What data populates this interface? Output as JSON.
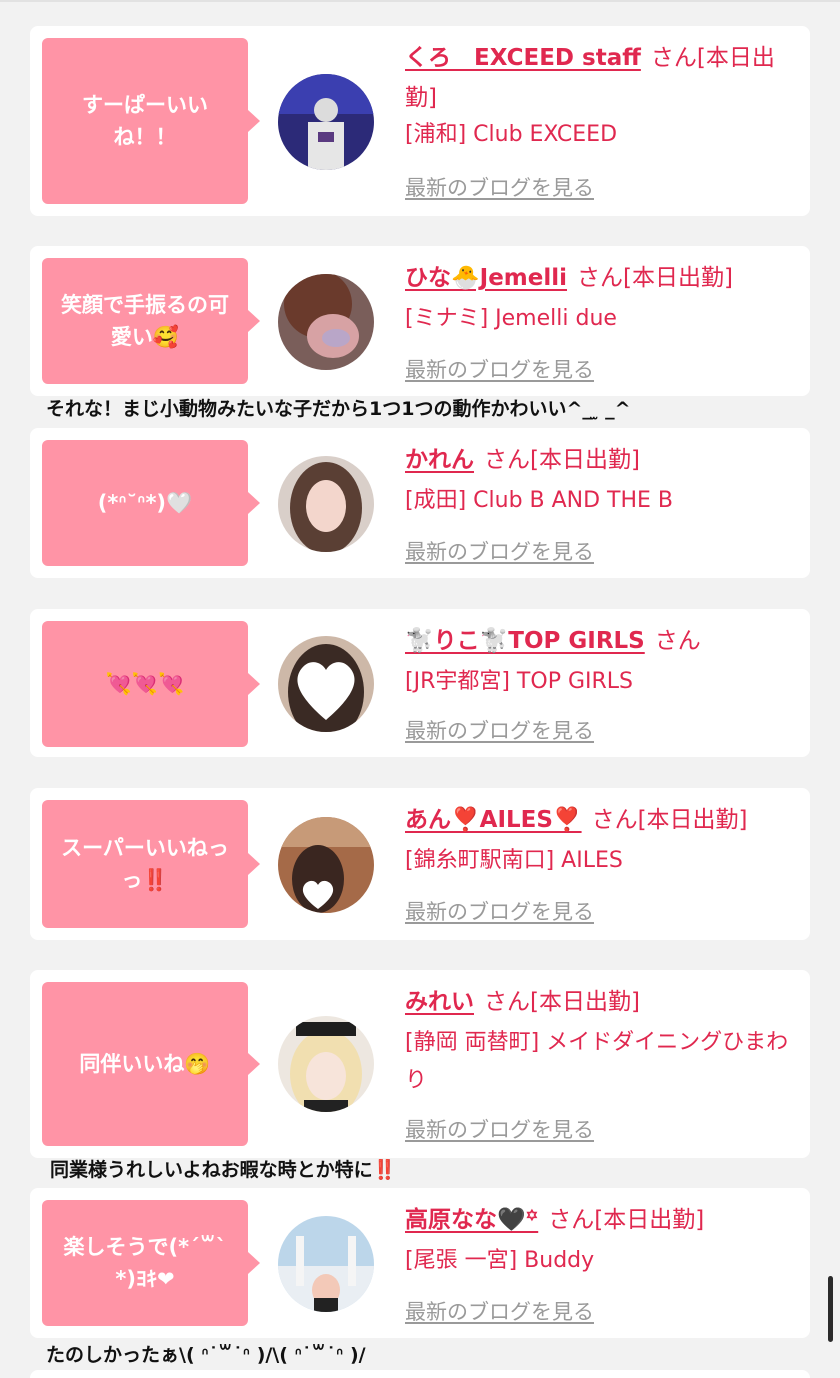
{
  "colors": {
    "accent": "#e0284f",
    "bubble": "#ff94a6",
    "link_gray": "#9a9a9a",
    "background": "#f2f2f2"
  },
  "blog_link_label": "最新のブログを見る",
  "san_label": "さん",
  "cards": [
    {
      "bubble": "すーぱーいいね！！",
      "name": "くろ　EXCEED staff",
      "suffix": "さん[本日出勤]",
      "shop": "[浦和] Club EXCEED"
    },
    {
      "bubble": "笑顔で手振るの可愛い🥰",
      "name": "ひな🐣Jemelli",
      "suffix": "さん[本日出勤]",
      "shop": "[ミナミ] Jemelli due"
    },
    {
      "bubble": "(*ᐢ˘ᐢ*)🤍",
      "name": "かれん",
      "suffix": "さん[本日出勤]",
      "shop": "[成田] Club B AND THE B"
    },
    {
      "bubble": "💘💘💘",
      "name": "🐩りこ🐩TOP GIRLS",
      "suffix": "さん",
      "shop": "[JR宇都宮] TOP GIRLS"
    },
    {
      "bubble": "スーパーいいねっっ‼️",
      "name": "あん❣️AILES❣️",
      "suffix": "さん[本日出勤]",
      "shop": "[錦糸町駅南口] AILES"
    },
    {
      "bubble": "同伴いいね🤭",
      "name": "みれい",
      "suffix": "さん[本日出勤]",
      "shop": "[静岡 両替町] メイドダイニングひまわり"
    },
    {
      "bubble": "楽しそうで(*´꒳`*)ﾖｷ❤",
      "name": "高原なな🖤꙳",
      "suffix": "さん[本日出勤]",
      "shop": "[尾張 一宮] Buddy"
    }
  ],
  "comments": [
    "それな！まじ小動物みたいな子だから1つ1つの動作かわいい^_ ̫ _^",
    "同業様うれしいよねお暇な時とか特に‼️",
    "たのしかったぁ\\( ᐢ˙꒳​˙ᐢ )/\\( ᐢ˙꒳​˙ᐢ )/"
  ]
}
